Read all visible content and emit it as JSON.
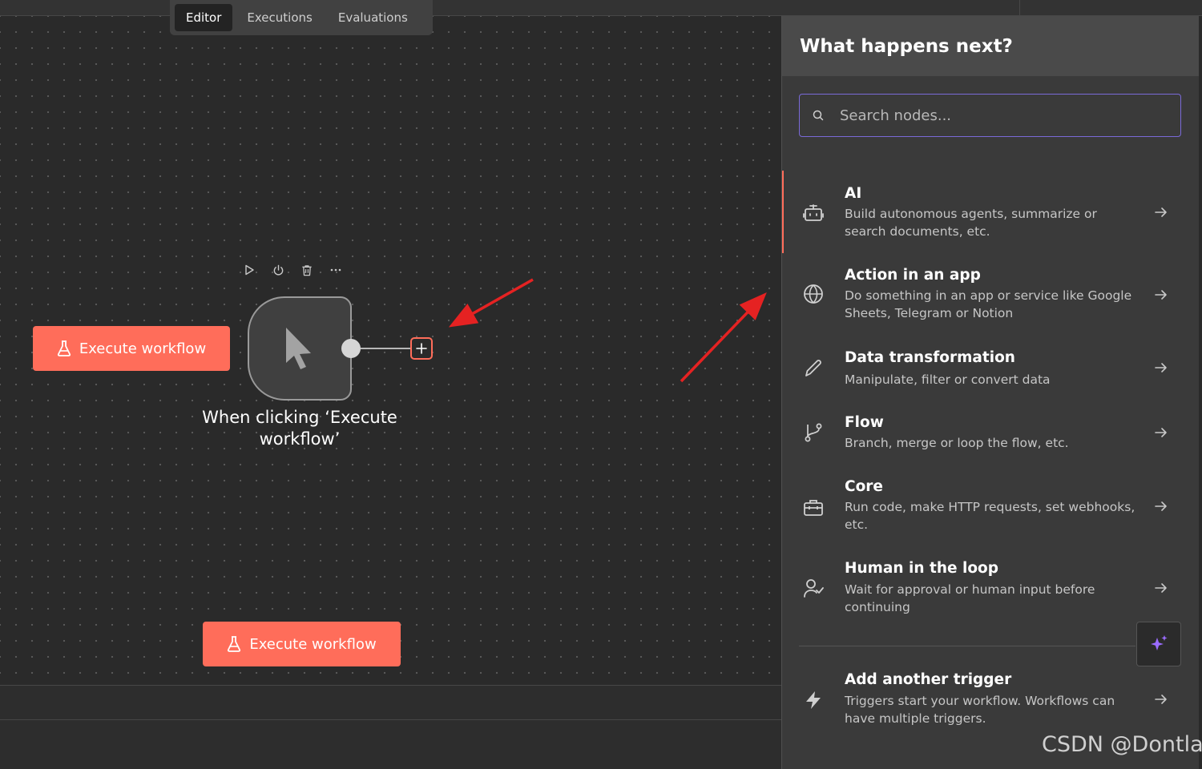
{
  "tabs": [
    {
      "label": "Editor"
    },
    {
      "label": "Executions"
    },
    {
      "label": "Evaluations"
    }
  ],
  "canvas": {
    "execute_label": "Execute workflow",
    "node_label": "When clicking ‘Execute workflow’"
  },
  "panel": {
    "title": "What happens next?",
    "search_placeholder": "Search nodes...",
    "categories": [
      {
        "title": "AI",
        "desc": "Build autonomous agents, summarize or search documents, etc.",
        "icon": "robot-icon"
      },
      {
        "title": "Action in an app",
        "desc": "Do something in an app or service like Google Sheets, Telegram or Notion",
        "icon": "globe-icon"
      },
      {
        "title": "Data transformation",
        "desc": "Manipulate, filter or convert data",
        "icon": "pen-icon"
      },
      {
        "title": "Flow",
        "desc": "Branch, merge or loop the flow, etc.",
        "icon": "git-branch-icon"
      },
      {
        "title": "Core",
        "desc": "Run code, make HTTP requests, set webhooks, etc.",
        "icon": "toolbox-icon"
      },
      {
        "title": "Human in the loop",
        "desc": "Wait for approval or human input before continuing",
        "icon": "user-check-icon"
      },
      {
        "title": "Add another trigger",
        "desc": "Triggers start your workflow. Workflows can have multiple triggers.",
        "icon": "bolt-icon"
      }
    ]
  },
  "watermark": "CSDN @Dontla",
  "colors": {
    "accent": "#ff6d5a",
    "search_border": "#7a6ad8",
    "ai_sparkle": "#9b6cff"
  }
}
